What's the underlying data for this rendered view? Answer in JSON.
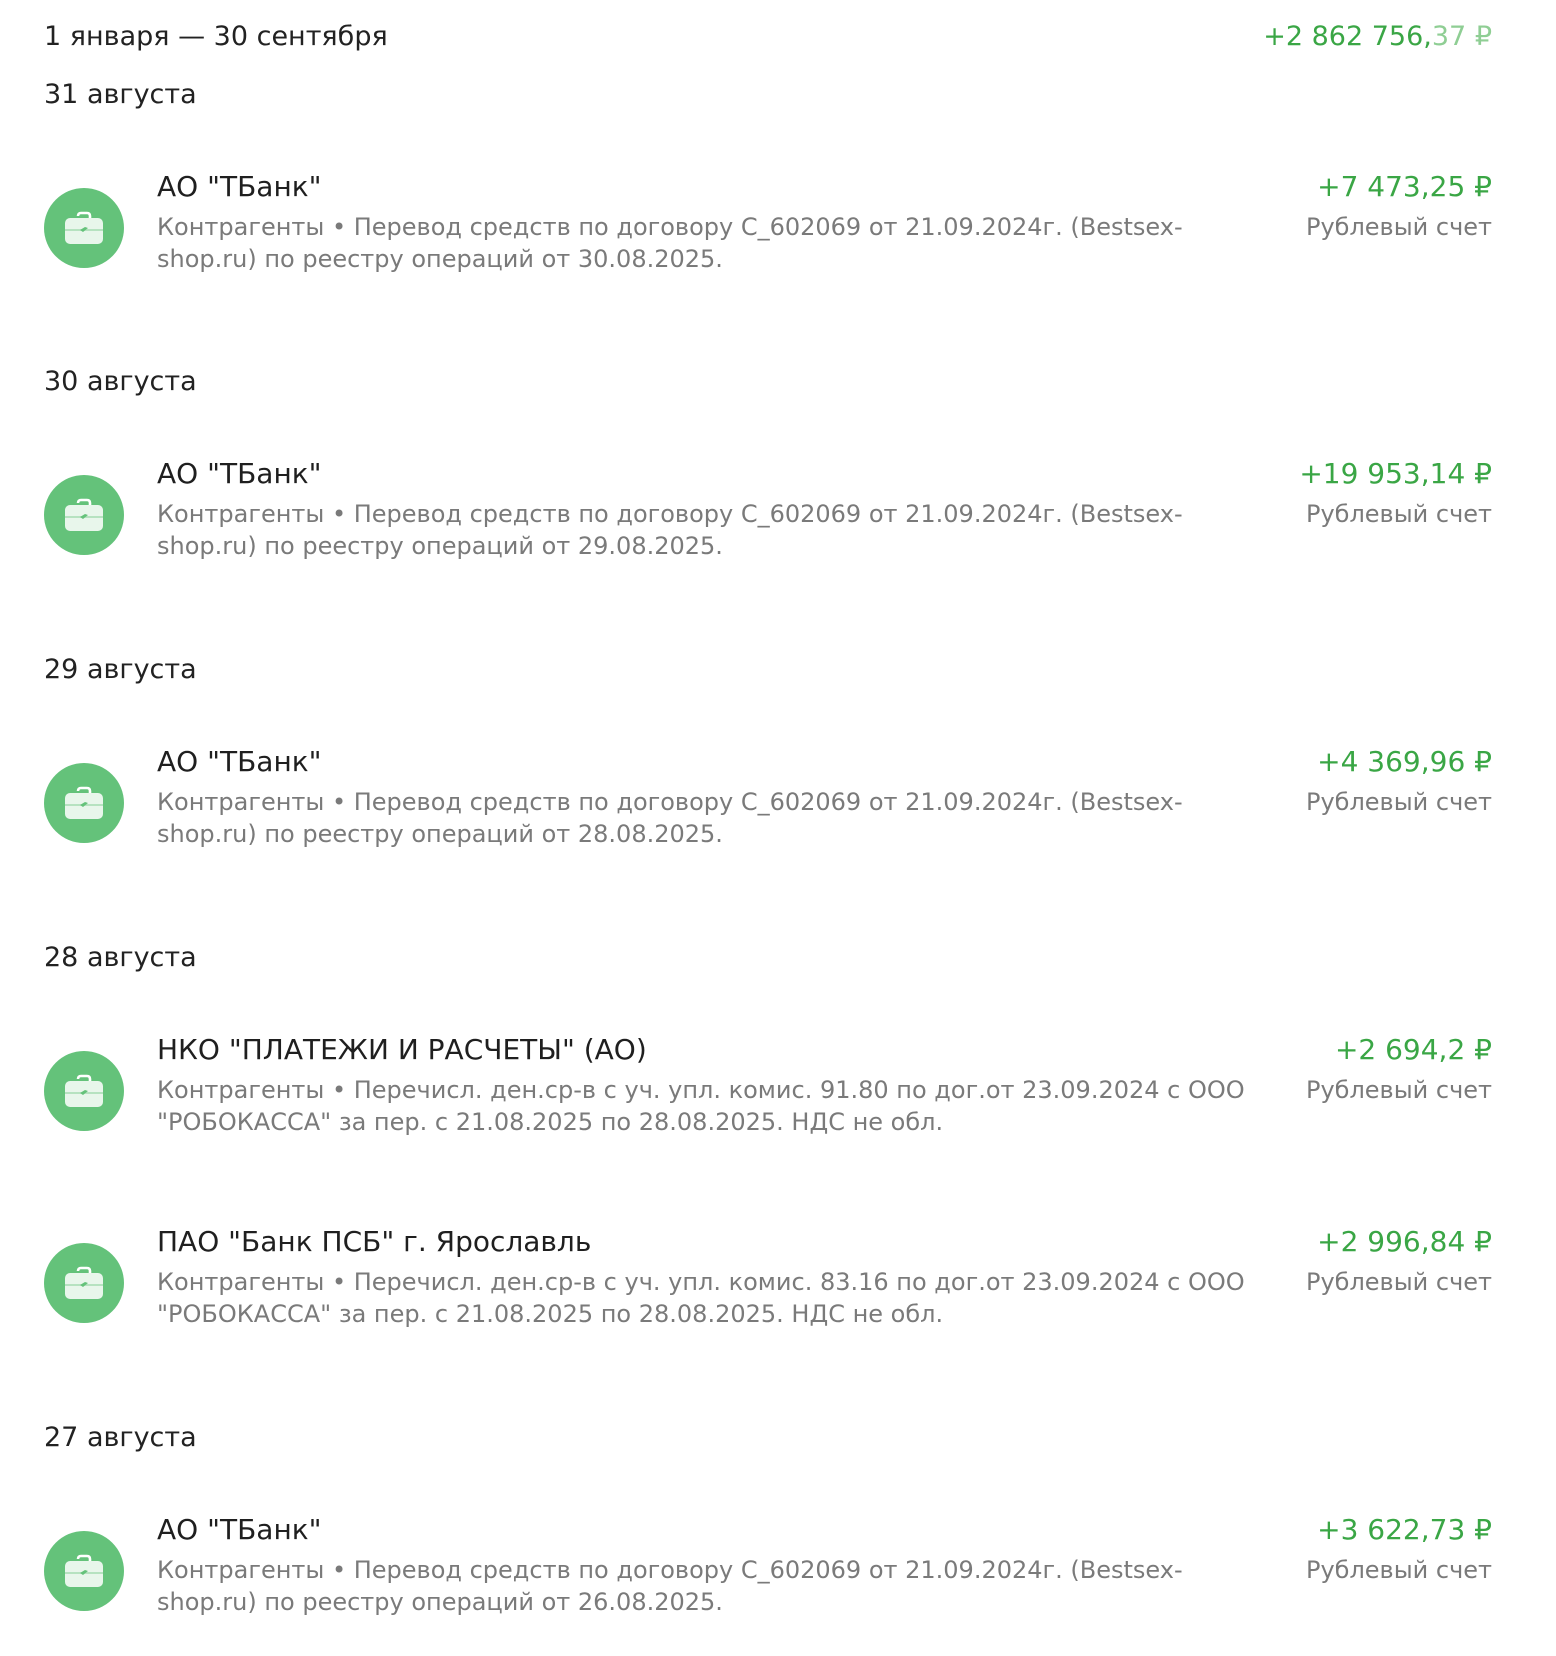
{
  "period": {
    "label": "1 января — 30 сентября",
    "total_main": "+2 862 756,",
    "total_cents": "37",
    "total_currency": " ₽"
  },
  "days": [
    {
      "date": "31 августа",
      "transactions": [
        {
          "title": "АО \"ТБанк\"",
          "description": "Контрагенты • Перевод средств по договору С_602069 от 21.09.2024г. (Bestsex-shop.ru) по реестру операций от 30.08.2025.",
          "amount": "+7 473,25 ₽",
          "account": "Рублевый счет",
          "icon": "briefcase-icon"
        }
      ]
    },
    {
      "date": "30 августа",
      "transactions": [
        {
          "title": "АО \"ТБанк\"",
          "description": "Контрагенты • Перевод средств по договору С_602069 от 21.09.2024г. (Bestsex-shop.ru) по реестру операций от 29.08.2025.",
          "amount": "+19 953,14 ₽",
          "account": "Рублевый счет",
          "icon": "briefcase-icon"
        }
      ]
    },
    {
      "date": "29 августа",
      "transactions": [
        {
          "title": "АО \"ТБанк\"",
          "description": "Контрагенты • Перевод средств по договору С_602069 от 21.09.2024г. (Bestsex-shop.ru) по реестру операций от 28.08.2025.",
          "amount": "+4 369,96 ₽",
          "account": "Рублевый счет",
          "icon": "briefcase-icon"
        }
      ]
    },
    {
      "date": "28 августа",
      "transactions": [
        {
          "title": "НКО \"ПЛАТЕЖИ И РАСЧЕТЫ\" (АО)",
          "description": "Контрагенты • Перечисл. ден.ср-в с уч. упл. комис. 91.80 по дог.от 23.09.2024 с ООО \"РОБОКАССА\" за пер. с 21.08.2025 по 28.08.2025. НДС не обл.",
          "amount": "+2 694,2 ₽",
          "account": "Рублевый счет",
          "icon": "briefcase-icon"
        },
        {
          "title": "ПАО \"Банк ПСБ\" г. Ярославль",
          "description": "Контрагенты • Перечисл. ден.ср-в с уч. упл. комис. 83.16 по дог.от 23.09.2024 с ООО \"РОБОКАССА\" за пер. с 21.08.2025 по 28.08.2025. НДС не обл.",
          "amount": "+2 996,84 ₽",
          "account": "Рублевый счет",
          "icon": "briefcase-icon"
        }
      ]
    },
    {
      "date": "27 августа",
      "transactions": [
        {
          "title": "АО \"ТБанк\"",
          "description": "Контрагенты • Перевод средств по договору С_602069 от 21.09.2024г. (Bestsex-shop.ru) по реестру операций от 26.08.2025.",
          "amount": "+3 622,73 ₽",
          "account": "Рублевый счет",
          "icon": "briefcase-icon"
        }
      ]
    }
  ]
}
